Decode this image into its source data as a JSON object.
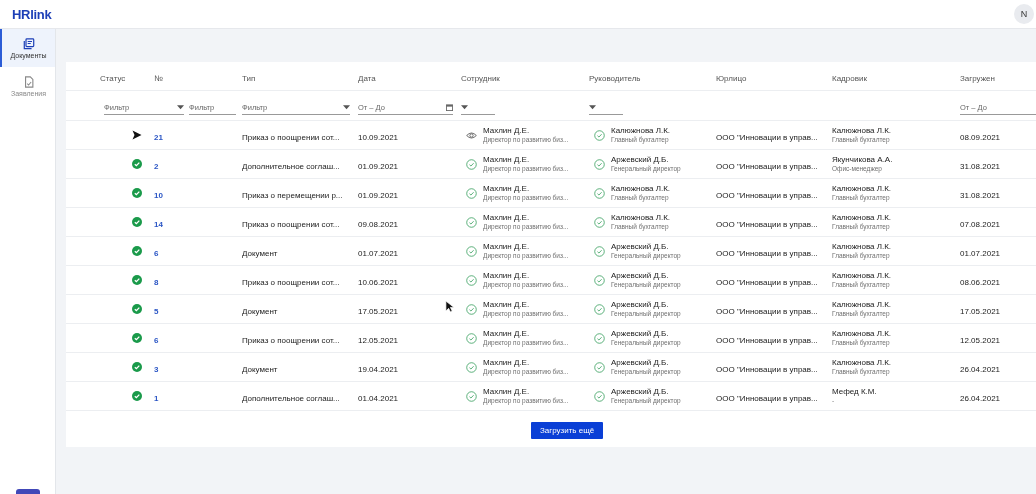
{
  "header": {
    "logo": "HRlink",
    "avatar": "N"
  },
  "sidebar": {
    "items": [
      {
        "label": "Документы",
        "selected": true
      },
      {
        "label": "Заявления",
        "selected": false
      }
    ]
  },
  "table": {
    "columns": [
      "Статус",
      "№",
      "Тип",
      "Дата",
      "Сотрудник",
      "Руководитель",
      "Юрлицо",
      "Кадровик",
      "Загружен"
    ],
    "filters": [
      {
        "kind": "select",
        "placeholder": "Фильтр"
      },
      {
        "kind": "text",
        "placeholder": "Фильтр"
      },
      {
        "kind": "select",
        "placeholder": "Фильтр"
      },
      {
        "kind": "date",
        "placeholder": "От – До"
      },
      {
        "kind": "select"
      },
      {
        "kind": "select"
      },
      {
        "kind": "none"
      },
      {
        "kind": "none"
      },
      {
        "kind": "text",
        "placeholder": "От – До"
      }
    ],
    "rows": [
      {
        "kind": "sent",
        "number": "21",
        "type": "Приказ о поощрении сот...",
        "date": "10.09.2021",
        "employee": {
          "name": "Махлин Д.Е.",
          "position": "Директор по развитию биз...",
          "kind": "viewed"
        },
        "manager": {
          "name": "Калюжнова Л.К.",
          "position": "Главный бухгалтер",
          "kind": "signed"
        },
        "entity": "ООО \"Инновации в управ...",
        "hr": {
          "name": "Калюжнова Л.К.",
          "position": "Главный бухгалтер"
        },
        "uploaded": "08.09.2021"
      },
      {
        "kind": "signed",
        "number": "2",
        "type": "Дополнительное соглаш...",
        "date": "01.09.2021",
        "employee": {
          "name": "Махлин Д.Е.",
          "position": "Директор по развитию биз...",
          "kind": "signed"
        },
        "manager": {
          "name": "Аржевский Д.Б.",
          "position": "Генеральный директор",
          "kind": "signed"
        },
        "entity": "ООО \"Инновации в управ...",
        "hr": {
          "name": "Якунчикова А.А.",
          "position": "Офис-менеджер"
        },
        "uploaded": "31.08.2021"
      },
      {
        "kind": "signed",
        "number": "10",
        "type": "Приказ о перемещении р...",
        "date": "01.09.2021",
        "employee": {
          "name": "Махлин Д.Е.",
          "position": "Директор по развитию биз...",
          "kind": "signed"
        },
        "manager": {
          "name": "Калюжнова Л.К.",
          "position": "Главный бухгалтер",
          "kind": "signed"
        },
        "entity": "ООО \"Инновации в управ...",
        "hr": {
          "name": "Калюжнова Л.К.",
          "position": "Главный бухгалтер"
        },
        "uploaded": "31.08.2021"
      },
      {
        "kind": "signed",
        "number": "14",
        "type": "Приказ о поощрении сот...",
        "date": "09.08.2021",
        "employee": {
          "name": "Махлин Д.Е.",
          "position": "Директор по развитию биз...",
          "kind": "signed"
        },
        "manager": {
          "name": "Калюжнова Л.К.",
          "position": "Главный бухгалтер",
          "kind": "signed"
        },
        "entity": "ООО \"Инновации в управ...",
        "hr": {
          "name": "Калюжнова Л.К.",
          "position": "Главный бухгалтер"
        },
        "uploaded": "07.08.2021"
      },
      {
        "kind": "signed",
        "number": "6",
        "type": "Документ",
        "date": "01.07.2021",
        "employee": {
          "name": "Махлин Д.Е.",
          "position": "Директор по развитию биз...",
          "kind": "signed"
        },
        "manager": {
          "name": "Аржевский Д.Б.",
          "position": "Генеральный директор",
          "kind": "signed"
        },
        "entity": "ООО \"Инновации в управ...",
        "hr": {
          "name": "Калюжнова Л.К.",
          "position": "Главный бухгалтер"
        },
        "uploaded": "01.07.2021"
      },
      {
        "kind": "signed",
        "number": "8",
        "type": "Приказ о поощрении сот...",
        "date": "10.06.2021",
        "employee": {
          "name": "Махлин Д.Е.",
          "position": "Директор по развитию биз...",
          "kind": "signed"
        },
        "manager": {
          "name": "Аржевский Д.Б.",
          "position": "Генеральный директор",
          "kind": "signed"
        },
        "entity": "ООО \"Инновации в управ...",
        "hr": {
          "name": "Калюжнова Л.К.",
          "position": "Главный бухгалтер"
        },
        "uploaded": "08.06.2021"
      },
      {
        "kind": "signed",
        "number": "5",
        "type": "Документ",
        "date": "17.05.2021",
        "employee": {
          "name": "Махлин Д.Е.",
          "position": "Директор по развитию биз...",
          "kind": "signed"
        },
        "manager": {
          "name": "Аржевский Д.Б.",
          "position": "Генеральный директор",
          "kind": "signed"
        },
        "entity": "ООО \"Инновации в управ...",
        "hr": {
          "name": "Калюжнова Л.К.",
          "position": "Главный бухгалтер"
        },
        "uploaded": "17.05.2021"
      },
      {
        "kind": "signed",
        "number": "6",
        "type": "Приказ о поощрении сот...",
        "date": "12.05.2021",
        "employee": {
          "name": "Махлин Д.Е.",
          "position": "Директор по развитию биз...",
          "kind": "signed"
        },
        "manager": {
          "name": "Аржевский Д.Б.",
          "position": "Генеральный директор",
          "kind": "signed"
        },
        "entity": "ООО \"Инновации в управ...",
        "hr": {
          "name": "Калюжнова Л.К.",
          "position": "Главный бухгалтер"
        },
        "uploaded": "12.05.2021"
      },
      {
        "kind": "signed",
        "number": "3",
        "type": "Документ",
        "date": "19.04.2021",
        "employee": {
          "name": "Махлин Д.Е.",
          "position": "Директор по развитию биз...",
          "kind": "signed"
        },
        "manager": {
          "name": "Аржевский Д.Б.",
          "position": "Генеральный директор",
          "kind": "signed"
        },
        "entity": "ООО \"Инновации в управ...",
        "hr": {
          "name": "Калюжнова Л.К.",
          "position": "Главный бухгалтер"
        },
        "uploaded": "26.04.2021"
      },
      {
        "kind": "signed",
        "number": "1",
        "type": "Дополнительное соглаш...",
        "date": "01.04.2021",
        "employee": {
          "name": "Махлин Д.Е.",
          "position": "Директор по развитию биз...",
          "kind": "signed"
        },
        "manager": {
          "name": "Аржевский Д.Б.",
          "position": "Генеральный директор",
          "kind": "signed"
        },
        "entity": "ООО \"Инновации в управ...",
        "hr": {
          "name": "Мефед К.М.",
          "position": "-"
        },
        "uploaded": "26.04.2021"
      }
    ],
    "load_more": "Загрузить ещё"
  }
}
